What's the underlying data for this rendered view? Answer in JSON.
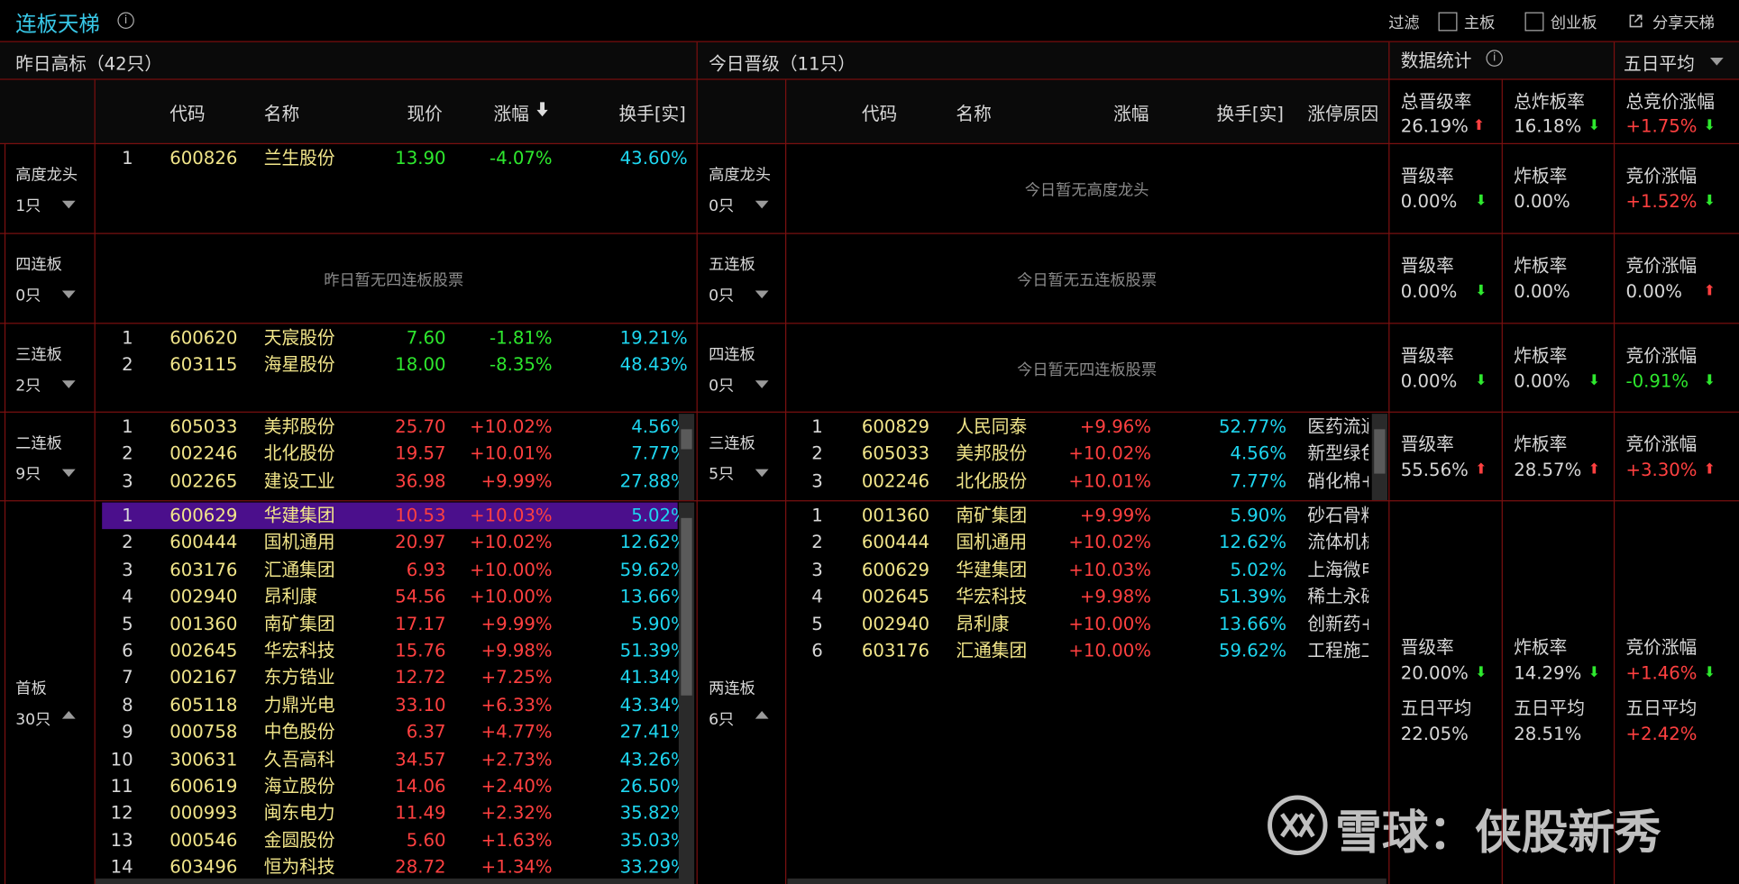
{
  "title": "连板天梯",
  "toolbar": {
    "filter": "过滤",
    "main": "主板",
    "gem": "创业板",
    "share": "分享天梯"
  },
  "left": {
    "header": "昨日高标（42只）",
    "cols": [
      "代码",
      "名称",
      "现价",
      "涨幅",
      "换手[实]"
    ],
    "groups": [
      {
        "name": "高度龙头",
        "count": "1只",
        "empty": "",
        "rows": [
          {
            "i": "1",
            "code": "600826",
            "name": "兰生股份",
            "price": "13.90",
            "chg": "-4.07%",
            "turn": "43.60%",
            "c": "green"
          }
        ]
      },
      {
        "name": "四连板",
        "count": "0只",
        "empty": "昨日暂无四连板股票",
        "rows": []
      },
      {
        "name": "三连板",
        "count": "2只",
        "empty": "",
        "rows": [
          {
            "i": "1",
            "code": "600620",
            "name": "天宸股份",
            "price": "7.60",
            "chg": "-1.81%",
            "turn": "19.21%",
            "c": "green"
          },
          {
            "i": "2",
            "code": "603115",
            "name": "海星股份",
            "price": "18.00",
            "chg": "-8.35%",
            "turn": "48.43%",
            "c": "green"
          }
        ]
      },
      {
        "name": "二连板",
        "count": "9只",
        "empty": "",
        "rows": [
          {
            "i": "1",
            "code": "605033",
            "name": "美邦股份",
            "price": "25.70",
            "chg": "+10.02%",
            "turn": "4.56%",
            "c": "red"
          },
          {
            "i": "2",
            "code": "002246",
            "name": "北化股份",
            "price": "19.57",
            "chg": "+10.01%",
            "turn": "7.77%",
            "c": "red"
          },
          {
            "i": "3",
            "code": "002265",
            "name": "建设工业",
            "price": "36.98",
            "chg": "+9.99%",
            "turn": "27.88%",
            "c": "red"
          }
        ]
      },
      {
        "name": "首板",
        "count": "30只",
        "empty": "",
        "rows": [
          {
            "i": "1",
            "code": "600629",
            "name": "华建集团",
            "price": "10.53",
            "chg": "+10.03%",
            "turn": "5.02%",
            "c": "red",
            "sel": true
          },
          {
            "i": "2",
            "code": "600444",
            "name": "国机通用",
            "price": "20.97",
            "chg": "+10.02%",
            "turn": "12.62%",
            "c": "red"
          },
          {
            "i": "3",
            "code": "603176",
            "name": "汇通集团",
            "price": "6.93",
            "chg": "+10.00%",
            "turn": "59.62%",
            "c": "red"
          },
          {
            "i": "4",
            "code": "002940",
            "name": "昂利康",
            "price": "54.56",
            "chg": "+10.00%",
            "turn": "13.66%",
            "c": "red"
          },
          {
            "i": "5",
            "code": "001360",
            "name": "南矿集团",
            "price": "17.17",
            "chg": "+9.99%",
            "turn": "5.90%",
            "c": "red"
          },
          {
            "i": "6",
            "code": "002645",
            "name": "华宏科技",
            "price": "15.76",
            "chg": "+9.98%",
            "turn": "51.39%",
            "c": "red"
          },
          {
            "i": "7",
            "code": "002167",
            "name": "东方锆业",
            "price": "12.72",
            "chg": "+7.25%",
            "turn": "41.34%",
            "c": "red"
          },
          {
            "i": "8",
            "code": "605118",
            "name": "力鼎光电",
            "price": "33.10",
            "chg": "+6.33%",
            "turn": "43.34%",
            "c": "red"
          },
          {
            "i": "9",
            "code": "000758",
            "name": "中色股份",
            "price": "6.37",
            "chg": "+4.77%",
            "turn": "27.41%",
            "c": "red"
          },
          {
            "i": "10",
            "code": "300631",
            "name": "久吾高科",
            "price": "34.57",
            "chg": "+2.73%",
            "turn": "43.26%",
            "c": "red"
          },
          {
            "i": "11",
            "code": "600619",
            "name": "海立股份",
            "price": "14.06",
            "chg": "+2.40%",
            "turn": "26.50%",
            "c": "red"
          },
          {
            "i": "12",
            "code": "000993",
            "name": "闽东电力",
            "price": "11.49",
            "chg": "+2.32%",
            "turn": "35.82%",
            "c": "red"
          },
          {
            "i": "13",
            "code": "000546",
            "name": "金圆股份",
            "price": "5.60",
            "chg": "+1.63%",
            "turn": "35.03%",
            "c": "red"
          },
          {
            "i": "14",
            "code": "603496",
            "name": "恒为科技",
            "price": "28.72",
            "chg": "+1.34%",
            "turn": "33.29%",
            "c": "red"
          }
        ]
      }
    ]
  },
  "mid": {
    "header": "今日晋级（11只）",
    "cols": [
      "代码",
      "名称",
      "涨幅",
      "换手[实]",
      "涨停原因"
    ],
    "groups": [
      {
        "name": "高度龙头",
        "count": "0只",
        "empty": "今日暂无高度龙头",
        "rows": []
      },
      {
        "name": "五连板",
        "count": "0只",
        "empty": "今日暂无五连板股票",
        "rows": []
      },
      {
        "name": "四连板",
        "count": "0只",
        "empty": "今日暂无四连板股票",
        "rows": []
      },
      {
        "name": "三连板",
        "count": "5只",
        "empty": "",
        "rows": [
          {
            "i": "1",
            "code": "600829",
            "name": "人民同泰",
            "chg": "+9.96%",
            "turn": "52.77%",
            "reason": "医药流通"
          },
          {
            "i": "2",
            "code": "605033",
            "name": "美邦股份",
            "chg": "+10.02%",
            "turn": "4.56%",
            "reason": "新型绿色"
          },
          {
            "i": "3",
            "code": "002246",
            "name": "北化股份",
            "chg": "+10.01%",
            "turn": "7.77%",
            "reason": "硝化棉+"
          }
        ]
      },
      {
        "name": "两连板",
        "count": "6只",
        "empty": "",
        "rows": [
          {
            "i": "1",
            "code": "001360",
            "name": "南矿集团",
            "chg": "+9.99%",
            "turn": "5.90%",
            "reason": "砂石骨料+"
          },
          {
            "i": "2",
            "code": "600444",
            "name": "国机通用",
            "chg": "+10.02%",
            "turn": "12.62%",
            "reason": "流体机械+"
          },
          {
            "i": "3",
            "code": "600629",
            "name": "华建集团",
            "chg": "+10.03%",
            "turn": "5.02%",
            "reason": "上海微电子"
          },
          {
            "i": "4",
            "code": "002645",
            "name": "华宏科技",
            "chg": "+9.98%",
            "turn": "51.39%",
            "reason": "稀土永磁+"
          },
          {
            "i": "5",
            "code": "002940",
            "name": "昂利康",
            "chg": "+10.00%",
            "turn": "13.66%",
            "reason": "创新药+化"
          },
          {
            "i": "6",
            "code": "603176",
            "name": "汇通集团",
            "chg": "+10.00%",
            "turn": "59.62%",
            "reason": "工程施工+"
          }
        ]
      }
    ]
  },
  "stats": {
    "header": "数据统计",
    "dropdown": "五日平均",
    "totals": [
      {
        "label": "总晋级率",
        "val": "26.19%",
        "arrow": "up",
        "c": "white"
      },
      {
        "label": "总炸板率",
        "val": "16.18%",
        "arrow": "down",
        "c": "white"
      },
      {
        "label": "总竞价涨幅",
        "val": "+1.75%",
        "arrow": "down",
        "c": "red"
      }
    ],
    "rows": [
      [
        {
          "label": "晋级率",
          "val": "0.00%",
          "arrow": "down",
          "c": "white"
        },
        {
          "label": "炸板率",
          "val": "0.00%",
          "arrow": "",
          "c": "white"
        },
        {
          "label": "竞价涨幅",
          "val": "+1.52%",
          "arrow": "down",
          "c": "red"
        }
      ],
      [
        {
          "label": "晋级率",
          "val": "0.00%",
          "arrow": "down",
          "c": "white"
        },
        {
          "label": "炸板率",
          "val": "0.00%",
          "arrow": "",
          "c": "white"
        },
        {
          "label": "竞价涨幅",
          "val": "0.00%",
          "arrow": "up",
          "c": "white"
        }
      ],
      [
        {
          "label": "晋级率",
          "val": "0.00%",
          "arrow": "down",
          "c": "white"
        },
        {
          "label": "炸板率",
          "val": "0.00%",
          "arrow": "down",
          "c": "white"
        },
        {
          "label": "竞价涨幅",
          "val": "-0.91%",
          "arrow": "down",
          "c": "green"
        }
      ],
      [
        {
          "label": "晋级率",
          "val": "55.56%",
          "arrow": "up",
          "c": "white"
        },
        {
          "label": "炸板率",
          "val": "28.57%",
          "arrow": "up",
          "c": "white"
        },
        {
          "label": "竞价涨幅",
          "val": "+3.30%",
          "arrow": "up",
          "c": "red"
        }
      ],
      [
        {
          "label": "晋级率",
          "val": "20.00%",
          "arrow": "down",
          "c": "white"
        },
        {
          "label": "炸板率",
          "val": "14.29%",
          "arrow": "down",
          "c": "white"
        },
        {
          "label": "竞价涨幅",
          "val": "+1.46%",
          "arrow": "down",
          "c": "red"
        }
      ]
    ],
    "five_day": [
      {
        "label": "五日平均",
        "val": "22.05%",
        "c": "white"
      },
      {
        "label": "五日平均",
        "val": "28.51%",
        "c": "white"
      },
      {
        "label": "五日平均",
        "val": "+2.42%",
        "c": "red"
      }
    ]
  },
  "watermark": "雪球：侠股新秀",
  "colors": {
    "red": "#ff4040",
    "green": "#2ee82e",
    "cyan": "#1ed6f0",
    "yellow": "#f2e68a",
    "border": "#7a1010",
    "selected": "#4b0f8c"
  }
}
